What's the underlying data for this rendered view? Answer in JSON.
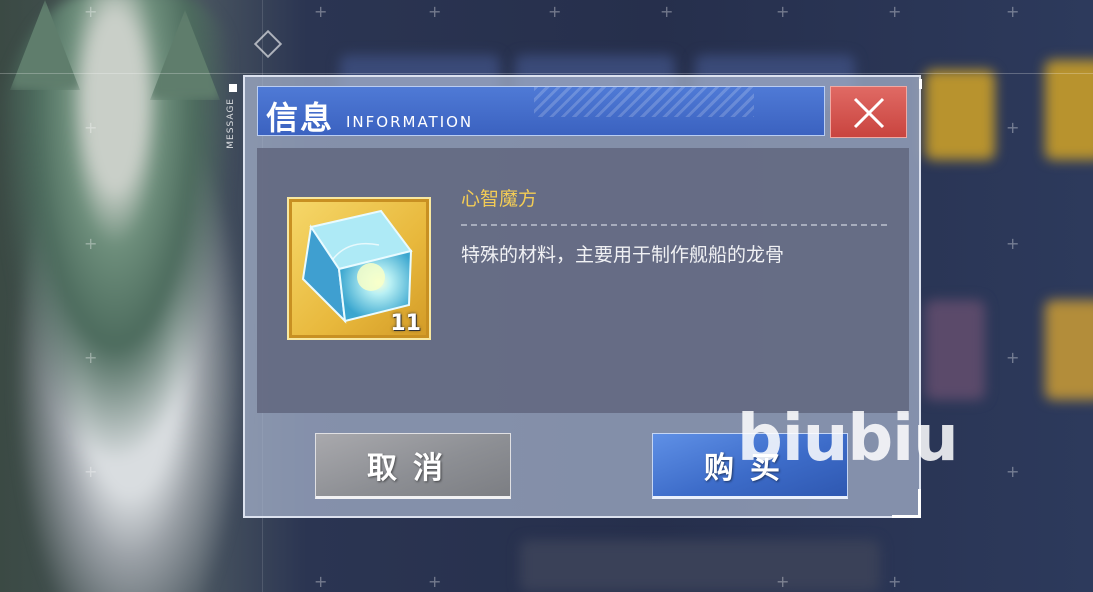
{
  "side_tab": {
    "label": "MESSAGE"
  },
  "dialog": {
    "title": "信息",
    "subtitle": "INFORMATION"
  },
  "item": {
    "name": "心智魔方",
    "count": "11",
    "description": "特殊的材料，主要用于制作舰船的龙骨",
    "icon": "cube-icon"
  },
  "buttons": {
    "cancel_label": "取消",
    "buy_label": "购买"
  },
  "watermark": "biubiu",
  "colors": {
    "title_bar": "#3f67c4",
    "close_button": "#d4514b",
    "item_name": "#f3cc55",
    "buy_button": "#3d6cc9",
    "cancel_button": "#8d8f94"
  }
}
